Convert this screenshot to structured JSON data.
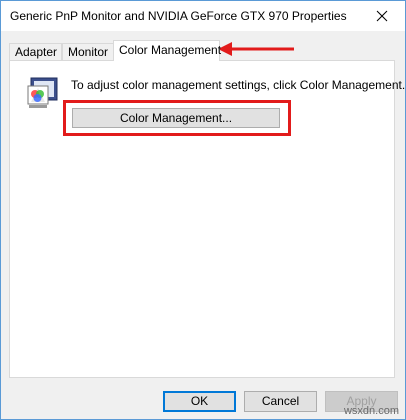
{
  "window": {
    "title": "Generic PnP Monitor and NVIDIA GeForce GTX 970 Properties"
  },
  "tabs": [
    {
      "label": "Adapter",
      "active": false
    },
    {
      "label": "Monitor",
      "active": false
    },
    {
      "label": "Color Management",
      "active": true
    }
  ],
  "panel": {
    "info_text": "To adjust color management settings, click Color Management.",
    "color_management_button": "Color Management..."
  },
  "footer": {
    "ok_label": "OK",
    "cancel_label": "Cancel",
    "apply_label": "Apply"
  },
  "watermark": "wsxdn.com",
  "colors": {
    "annotation_red": "#e21b1b",
    "default_button_border": "#0078d7",
    "window_border": "#5a9ad6"
  },
  "icons": {
    "close": "close-icon",
    "monitor": "color-monitor-icon",
    "annotation": "red-arrow-icon"
  }
}
